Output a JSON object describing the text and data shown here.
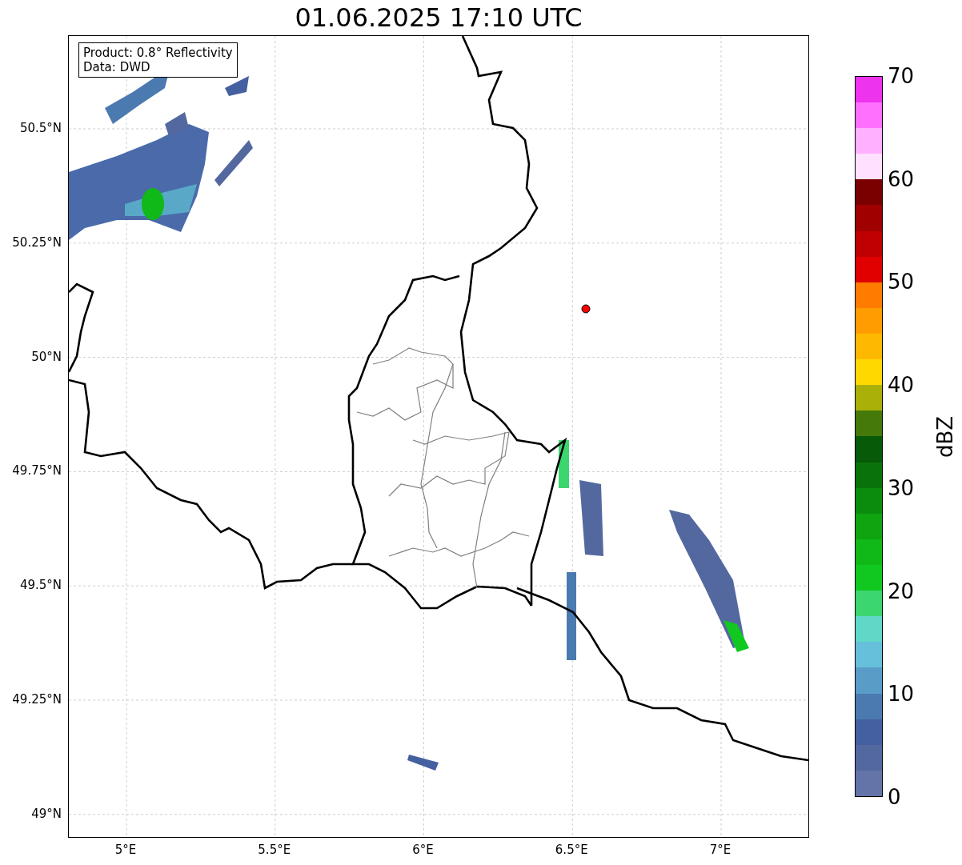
{
  "title": "01.06.2025 17:10 UTC",
  "info_box": [
    "Product: 0.8° Reflectivity",
    "Data: DWD"
  ],
  "map": {
    "y_ticks": [
      "50.5°N",
      "50.25°N",
      "50°N",
      "49.75°N",
      "49.5°N",
      "49.25°N",
      "49°N"
    ],
    "x_ticks": [
      "5°E",
      "5.5°E",
      "6°E",
      "6.5°E",
      "7°E"
    ]
  },
  "colorbar": {
    "label": "dBZ",
    "ticks": [
      "70",
      "60",
      "50",
      "40",
      "30",
      "20",
      "10",
      "0"
    ],
    "bands": [
      {
        "color": "#6474a8"
      },
      {
        "color": "#5468a0"
      },
      {
        "color": "#4560a0"
      },
      {
        "color": "#4a7ab0"
      },
      {
        "color": "#5a9cc8"
      },
      {
        "color": "#66c0dc"
      },
      {
        "color": "#60d8c8"
      },
      {
        "color": "#3cd670"
      },
      {
        "color": "#10c820"
      },
      {
        "color": "#10b818"
      },
      {
        "color": "#10a410"
      },
      {
        "color": "#0c8c0c"
      },
      {
        "color": "#0a720a"
      },
      {
        "color": "#075a07"
      },
      {
        "color": "#457a0a"
      },
      {
        "color": "#aab008"
      },
      {
        "color": "#ffd800"
      },
      {
        "color": "#ffb800"
      },
      {
        "color": "#ff9c00"
      },
      {
        "color": "#ff7c00"
      },
      {
        "color": "#e00000"
      },
      {
        "color": "#c00000"
      },
      {
        "color": "#a00000"
      },
      {
        "color": "#7a0000"
      },
      {
        "color": "#ffe0ff"
      },
      {
        "color": "#ffb0ff"
      },
      {
        "color": "#ff70ff"
      },
      {
        "color": "#ee33ee"
      }
    ]
  }
}
